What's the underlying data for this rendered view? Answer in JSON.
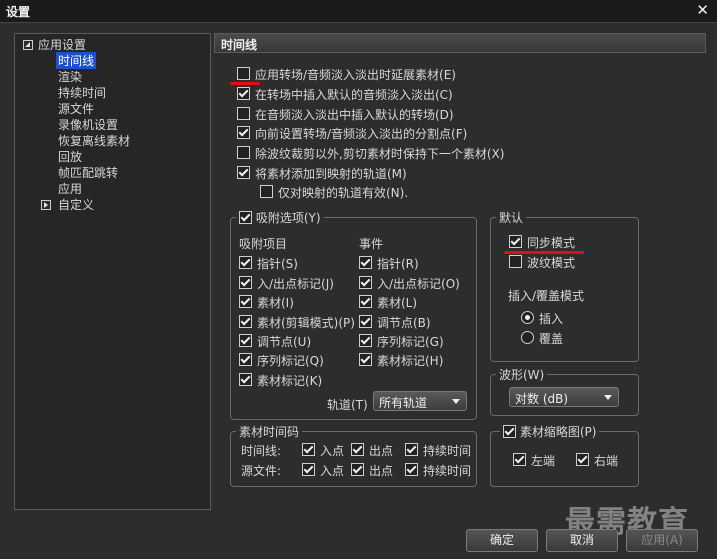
{
  "window": {
    "title": "设置"
  },
  "tree": {
    "root": "应用设置",
    "items": [
      "时间线",
      "渲染",
      "持续时间",
      "源文件",
      "录像机设置",
      "恢复离线素材",
      "回放",
      "帧匹配跳转",
      "应用"
    ],
    "selected": "时间线",
    "custom": "自定义"
  },
  "section": {
    "title": "时间线"
  },
  "options": [
    {
      "label": "应用转场/音频淡入淡出时延展素材(E)",
      "checked": false
    },
    {
      "label": "在转场中插入默认的音频淡入淡出(C)",
      "checked": true
    },
    {
      "label": "在音频淡入淡出中插入默认的转场(D)",
      "checked": false
    },
    {
      "label": "向前设置转场/音频淡入淡出的分割点(F)",
      "checked": true
    },
    {
      "label": "除波纹裁剪以外,剪切素材时保持下一个素材(X)",
      "checked": false
    },
    {
      "label": "将素材添加到映射的轨道(M)",
      "checked": true
    },
    {
      "label": "仅对映射的轨道有效(N).",
      "checked": false
    }
  ],
  "snap": {
    "title": "吸附选项(Y)",
    "checked": true,
    "items_header": "吸附项目",
    "events_header": "事件",
    "items": [
      {
        "label": "指针(S)",
        "checked": true
      },
      {
        "label": "入/出点标记(J)",
        "checked": true
      },
      {
        "label": "素材(I)",
        "checked": true
      },
      {
        "label": "素材(剪辑模式)(P)",
        "checked": true
      },
      {
        "label": "调节点(U)",
        "checked": true
      },
      {
        "label": "序列标记(Q)",
        "checked": true
      },
      {
        "label": "素材标记(K)",
        "checked": true
      }
    ],
    "events": [
      {
        "label": "指针(R)",
        "checked": true
      },
      {
        "label": "入/出点标记(O)",
        "checked": true
      },
      {
        "label": "素材(L)",
        "checked": true
      },
      {
        "label": "调节点(B)",
        "checked": true
      },
      {
        "label": "序列标记(G)",
        "checked": true
      },
      {
        "label": "素材标记(H)",
        "checked": true
      }
    ],
    "track_label": "轨道(T)",
    "track_value": "所有轨道"
  },
  "default": {
    "title": "默认",
    "sync": {
      "label": "同步模式",
      "checked": true
    },
    "ripple": {
      "label": "波纹模式",
      "checked": false
    },
    "insert_mode_label": "插入/覆盖模式",
    "insert": {
      "label": "插入",
      "selected": true
    },
    "overwrite": {
      "label": "覆盖",
      "selected": false
    }
  },
  "waveform": {
    "title": "波形(W)",
    "value": "对数 (dB)"
  },
  "timecode": {
    "title": "素材时间码",
    "rows": [
      {
        "label": "时间线:",
        "in": "入点",
        "out": "出点",
        "dur": "持续时间"
      },
      {
        "label": "源文件:",
        "in": "入点",
        "out": "出点",
        "dur": "持续时间"
      }
    ]
  },
  "thumbnail": {
    "title": "素材缩略图(P)",
    "checked": true,
    "left": "左端",
    "right": "右端"
  },
  "buttons": {
    "ok": "确定",
    "cancel": "取消",
    "apply": "应用(A)"
  },
  "watermark": "最需教育",
  "colors": {
    "selection": "#1f4fd0",
    "annotation": "#e01010"
  }
}
